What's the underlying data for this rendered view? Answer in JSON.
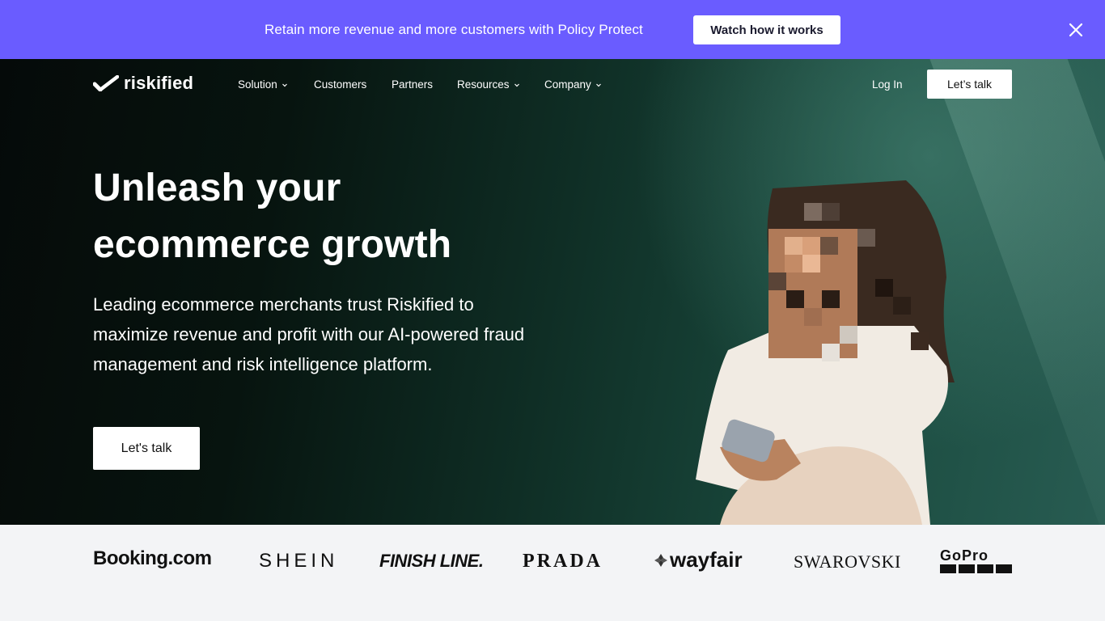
{
  "promo": {
    "text": "Retain more revenue and more customers with Policy Protect",
    "button": "Watch how it works",
    "close_icon": "close-icon"
  },
  "nav": {
    "logo": "riskified",
    "items": [
      {
        "label": "Solution",
        "dropdown": true
      },
      {
        "label": "Customers",
        "dropdown": false
      },
      {
        "label": "Partners",
        "dropdown": false
      },
      {
        "label": "Resources",
        "dropdown": true
      },
      {
        "label": "Company",
        "dropdown": true
      }
    ],
    "login": "Log In",
    "cta": "Let’s talk"
  },
  "hero": {
    "headline_line1": "Unleash your",
    "headline_line2": "ecommerce growth",
    "subcopy": "Leading ecommerce merchants trust Riskified to maximize revenue and profit with our AI-powered fraud management and risk intelligence platform.",
    "cta": "Let's talk"
  },
  "logos": {
    "booking": "Booking.com",
    "shein": "SHEIN",
    "finishline": "FINISH LINE.",
    "prada": "PRADA",
    "wayfair": "wayfair",
    "swarovski": "SWAROVSKI",
    "gopro": "GoPro"
  },
  "colors": {
    "promo_bg": "#6a5cff",
    "hero_dark": "#07140f",
    "hero_teal": "#285c52",
    "logos_bg": "#f3f4f6"
  }
}
